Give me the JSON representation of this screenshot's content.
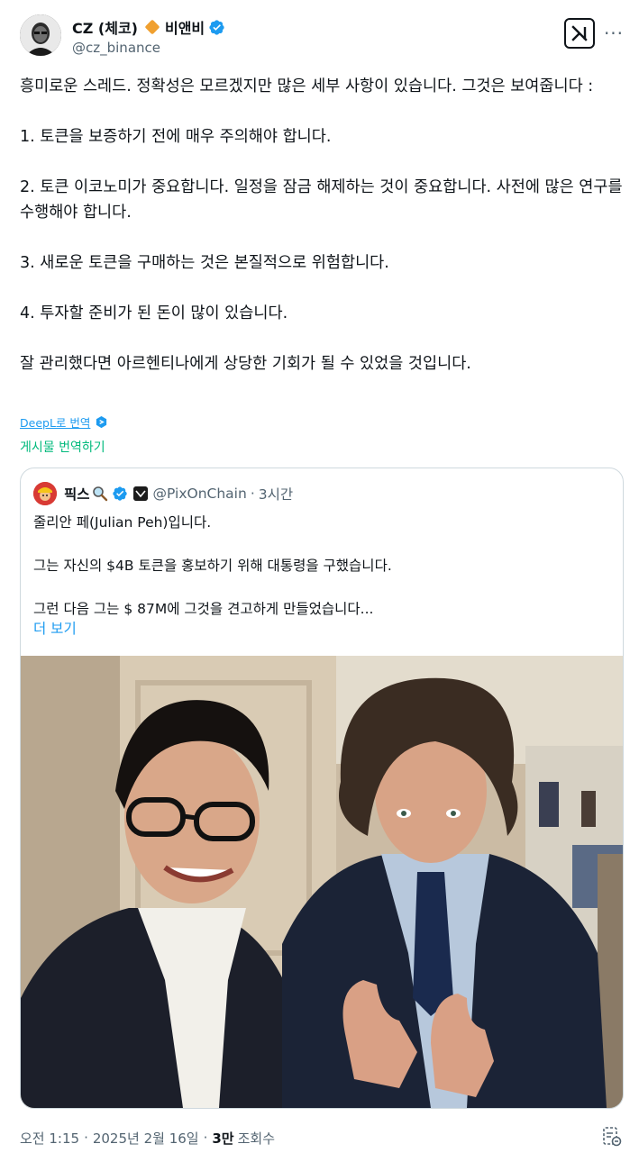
{
  "author": {
    "display_name": "CZ (체코)",
    "name_suffix": "비앤비",
    "handle": "@cz_binance",
    "diamond_color": "#f0a030",
    "verified_color": "#1d9bf0"
  },
  "header_actions": {
    "grok_icon": "grok-icon",
    "more_label": "···"
  },
  "tweet": {
    "line1": "흥미로운 스레드. 정확성은 모르겠지만 많은 세부 사항이 있습니다. 그것은 보여줍니다 :",
    "point1": "1. 토큰을 보증하기 전에 매우 주의해야 합니다.",
    "point2": "2. 토큰 이코노미가 중요합니다. 일정을 잠금 해제하는 것이 중요합니다. 사전에 많은 연구를 수행해야 합니다.",
    "point3": "3. 새로운 토큰을 구매하는 것은 본질적으로 위험합니다.",
    "point4": "4. 투자할 준비가 된 돈이 많이 있습니다.",
    "closing": "잘 관리했다면 아르헨티나에게 상당한 기회가 될 수 있었을 것입니다."
  },
  "translation": {
    "deepl_label": "DeepL로 번역",
    "translate_post": "게시물 번역하기"
  },
  "quote": {
    "name": "픽스",
    "handle": "@PixOnChain",
    "dot": "·",
    "time": "3시간",
    "line1": "줄리안 페(Julian Peh)입니다.",
    "line2": "그는 자신의 $4B 토큰을 홍보하기 위해 대통령을 구했습니다.",
    "line3": "그런 다음 그는 $ 87M에 그것을 견고하게 만들었습니다...",
    "more": "더 보기"
  },
  "footer": {
    "time": "오전 1:15",
    "sep1": "·",
    "date": "2025년 2월 16일",
    "sep2": "·",
    "views_num": "3만",
    "views_label": "조회수"
  },
  "colors": {
    "link_blue": "#1d9bf0",
    "translate_green": "#00ba7c",
    "muted": "#536471",
    "border": "#cfd9de"
  }
}
